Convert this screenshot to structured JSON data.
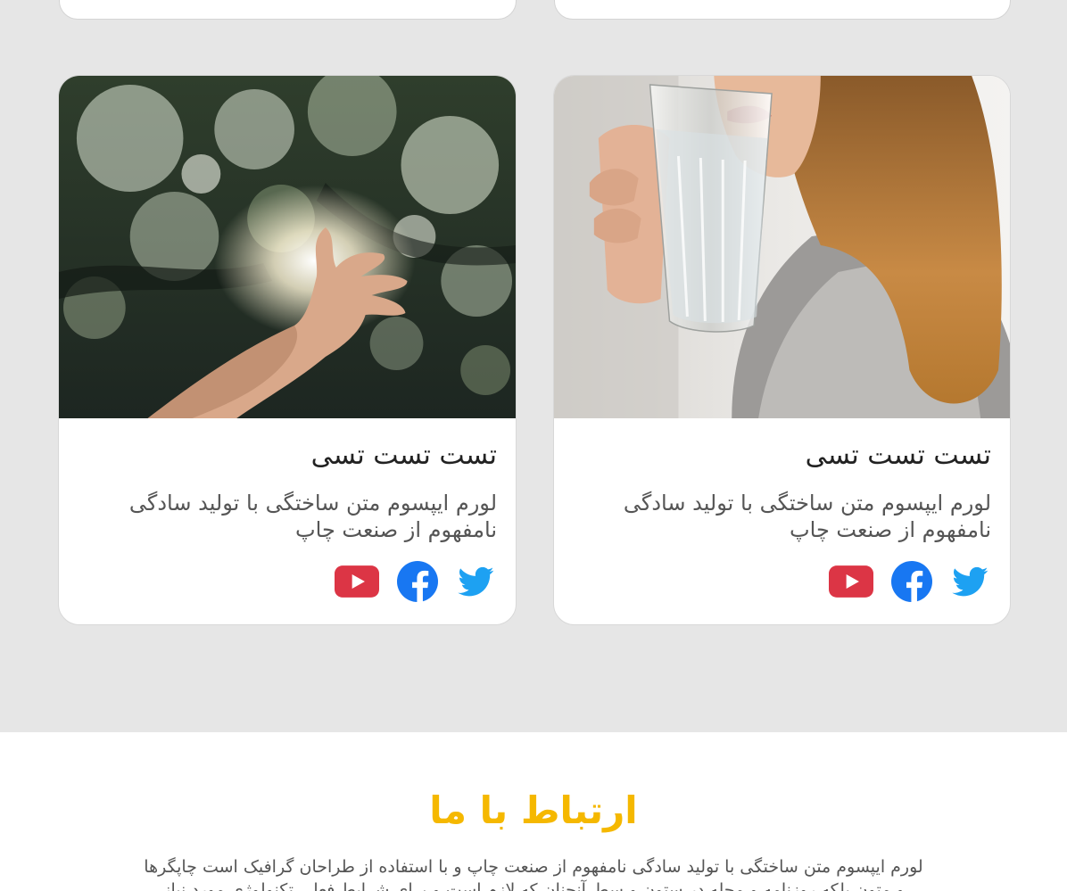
{
  "cards": [
    {
      "title": "تست تست تسی",
      "text": "لورم ایپسوم متن ساختگی با تولید سادگی نامفهوم از صنعت چاپ",
      "social": [
        "twitter-icon",
        "facebook-icon",
        "youtube-icon"
      ]
    },
    {
      "title": "تست تست تسی",
      "text": "لورم ایپسوم متن ساختگی با تولید سادگی نامفهوم از صنعت چاپ",
      "social": [
        "twitter-icon",
        "facebook-icon",
        "youtube-icon"
      ]
    }
  ],
  "contact": {
    "title": "ارتباط با ما",
    "text": "لورم ایپسوم متن ساختگی با تولید سادگی نامفهوم از صنعت چاپ و با استفاده از طراحان گرافیک است چاپگرها و متون بلکه روزنامه و مجله در ستون و سطرآنچنان که لازم است و برای شرایط فعلی تکنولوژی مورد نیاز"
  },
  "colors": {
    "accent": "#f5b800",
    "twitter": "#1da1f2",
    "facebook": "#1877f2",
    "youtube": "#dc3545"
  }
}
